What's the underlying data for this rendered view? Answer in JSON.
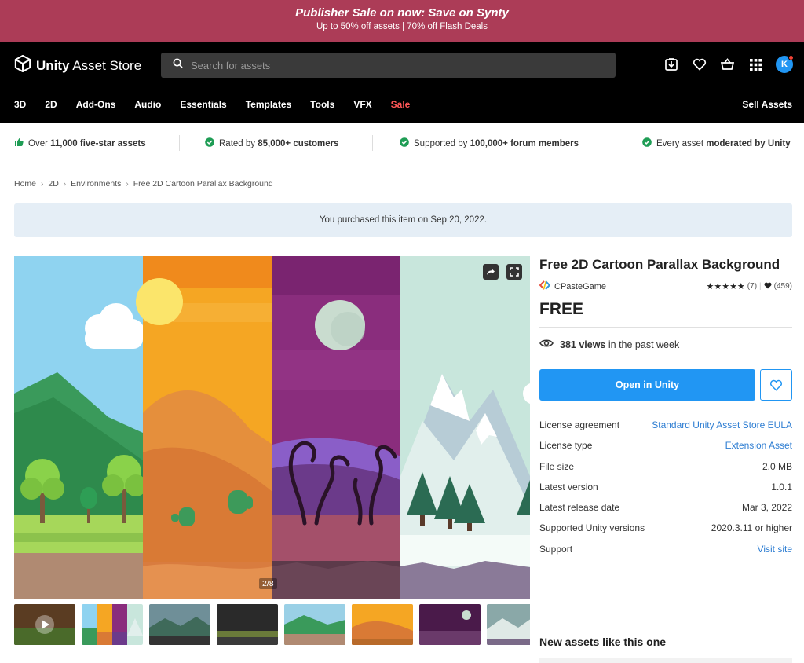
{
  "promo": {
    "headline": "Publisher Sale on now: Save on Synty",
    "subline": "Up to 50% off assets | 70% off Flash Deals"
  },
  "header": {
    "logo_bold": "Unity",
    "logo_rest": " Asset Store",
    "search_placeholder": "Search for assets",
    "avatar_initial": "K",
    "nav": [
      "3D",
      "2D",
      "Add-Ons",
      "Audio",
      "Essentials",
      "Templates",
      "Tools",
      "VFX",
      "Sale"
    ],
    "sell_assets": "Sell Assets"
  },
  "trust": [
    {
      "pre": "Over ",
      "bold": "11,000 five-star assets",
      "post": ""
    },
    {
      "pre": "Rated by ",
      "bold": "85,000+ customers",
      "post": ""
    },
    {
      "pre": "Supported by ",
      "bold": "100,000+ forum members",
      "post": ""
    },
    {
      "pre": "Every asset ",
      "bold": "moderated by Unity",
      "post": ""
    }
  ],
  "breadcrumb": [
    "Home",
    "2D",
    "Environments",
    "Free 2D Cartoon Parallax Background"
  ],
  "purchase_notice": "You purchased this item on Sep 20, 2022.",
  "gallery": {
    "counter": "2/8"
  },
  "asset": {
    "title": "Free 2D Cartoon Parallax Background",
    "publisher": "CPasteGame",
    "stars": "★★★★★",
    "rating_count": "(7)",
    "favorites": "(459)",
    "price": "FREE",
    "views_count": "381 views",
    "views_suffix": " in the past week",
    "open_button": "Open in Unity"
  },
  "details": [
    {
      "key": "License agreement",
      "value": "Standard Unity Asset Store EULA",
      "link": true
    },
    {
      "key": "License type",
      "value": "Extension Asset",
      "link": true
    },
    {
      "key": "File size",
      "value": "2.0 MB",
      "link": false
    },
    {
      "key": "Latest version",
      "value": "1.0.1",
      "link": false
    },
    {
      "key": "Latest release date",
      "value": "Mar 3, 2022",
      "link": false
    },
    {
      "key": "Supported Unity versions",
      "value": "2020.3.11 or higher",
      "link": false
    },
    {
      "key": "Support",
      "value": "Visit site",
      "link": true
    }
  ],
  "new_assets_heading": "New assets like this one",
  "colors": {
    "promo_bg": "#ac3c57",
    "accent_blue": "#2196f3",
    "sale_red": "#ff5757",
    "trust_green": "#1f9d55"
  }
}
